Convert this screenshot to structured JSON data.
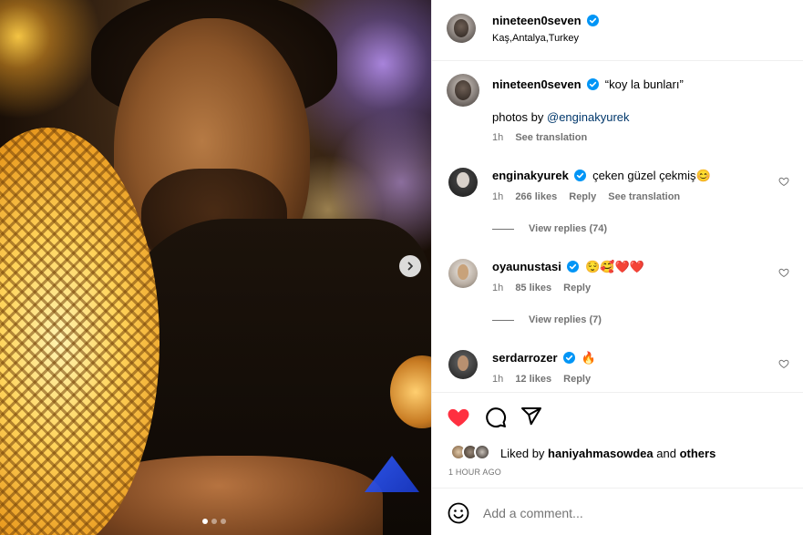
{
  "header": {
    "username": "nineteen0seven",
    "location": "Kaş,Antalya,Turkey"
  },
  "caption": {
    "username": "nineteen0seven",
    "text": "“koy la bunları”",
    "credit_prefix": "photos by ",
    "credit_mention": "@enginakyurek",
    "time": "1h",
    "see_translation": "See translation"
  },
  "comments": [
    {
      "username": "enginakyurek",
      "text": "çeken güzel çekmiş",
      "emoji": "😊",
      "time": "1h",
      "likes": "266 likes",
      "reply": "Reply",
      "see_translation": "See translation",
      "view_replies": "View replies (74)"
    },
    {
      "username": "oyaunustasi",
      "text": "",
      "emoji": "😌🥰❤️❤️",
      "time": "1h",
      "likes": "85 likes",
      "reply": "Reply",
      "view_replies": "View replies (7)"
    },
    {
      "username": "serdarrozer",
      "text": "",
      "emoji": "🔥",
      "time": "1h",
      "likes": "12 likes",
      "reply": "Reply"
    }
  ],
  "likes": {
    "prefix": "Liked by ",
    "user": "haniyahmasowdea",
    "middle": " and ",
    "others": "others"
  },
  "timestamp": "1 HOUR AGO",
  "add_comment": {
    "placeholder": "Add a comment..."
  },
  "carousel": {
    "current": 1,
    "total": 3
  },
  "colors": {
    "heart": "#ff3040",
    "verified": "#0095f6",
    "mention": "#00376b",
    "secondary_text": "#737373"
  }
}
